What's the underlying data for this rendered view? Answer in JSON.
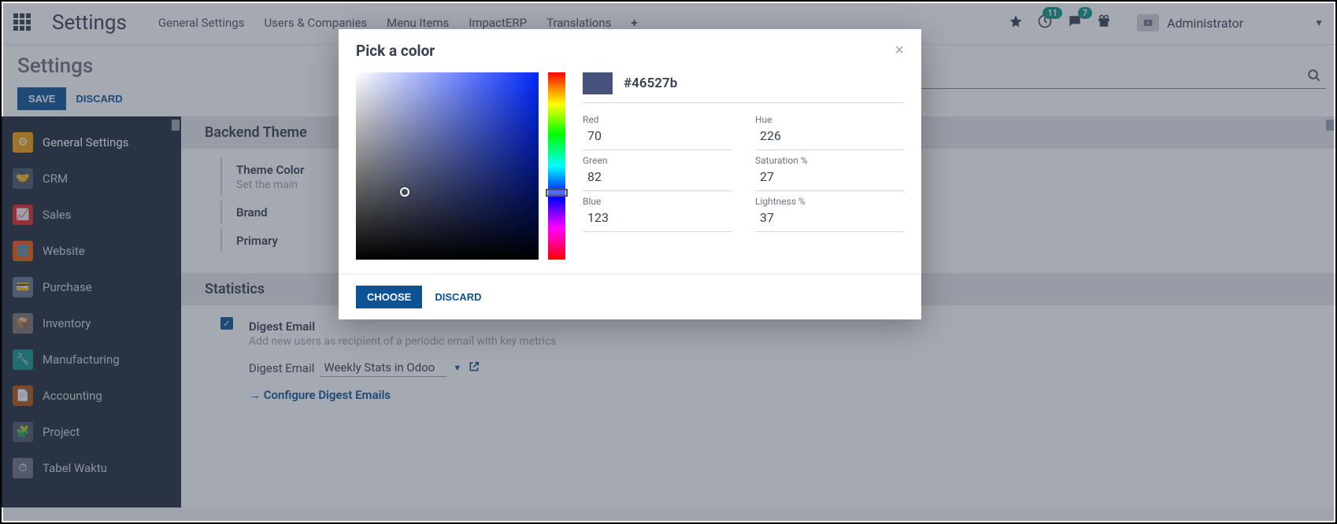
{
  "topbar": {
    "app_title": "Settings",
    "nav": [
      "General Settings",
      "Users & Companies",
      "Menu Items",
      "ImpactERP",
      "Translations"
    ],
    "badge_clock": "11",
    "badge_chat": "7",
    "user": "Administrator"
  },
  "control": {
    "heading": "Settings",
    "save": "SAVE",
    "discard": "DISCARD"
  },
  "sidebar": [
    {
      "label": "General Settings",
      "color": "#f59e0b",
      "active": true,
      "glyph": "⚙"
    },
    {
      "label": "CRM",
      "color": "#475569",
      "glyph": "🤝"
    },
    {
      "label": "Sales",
      "color": "#dc2626",
      "glyph": "📈"
    },
    {
      "label": "Website",
      "color": "#ea580c",
      "glyph": "🌐"
    },
    {
      "label": "Purchase",
      "color": "#64748b",
      "glyph": "💳"
    },
    {
      "label": "Inventory",
      "color": "#78716c",
      "glyph": "📦"
    },
    {
      "label": "Manufacturing",
      "color": "#0d9488",
      "glyph": "🔧"
    },
    {
      "label": "Accounting",
      "color": "#b45309",
      "glyph": "📄"
    },
    {
      "label": "Project",
      "color": "#475569",
      "glyph": "🧩"
    },
    {
      "label": "Tabel Waktu",
      "color": "#6b7280",
      "glyph": "⏱"
    }
  ],
  "backend": {
    "section": "Backend Theme",
    "theme_color_label": "Theme Color",
    "theme_color_help": "Set the main",
    "brand_label": "Brand",
    "primary_label": "Primary"
  },
  "stats": {
    "section": "Statistics",
    "digest_label": "Digest Email",
    "digest_help": "Add new users as recipient of a periodic email with key metrics",
    "digest_field_label": "Digest Email",
    "digest_value": "Weekly Stats in Odoo",
    "configure_link": "Configure Digest Emails"
  },
  "modal": {
    "title": "Pick a color",
    "hex": "#46527b",
    "choose": "CHOOSE",
    "discard": "DISCARD",
    "labels": {
      "red": "Red",
      "green": "Green",
      "blue": "Blue",
      "hue": "Hue",
      "sat": "Saturation %",
      "light": "Lightness %"
    },
    "vals": {
      "red": "70",
      "green": "82",
      "blue": "123",
      "hue": "226",
      "sat": "27",
      "light": "37"
    }
  }
}
